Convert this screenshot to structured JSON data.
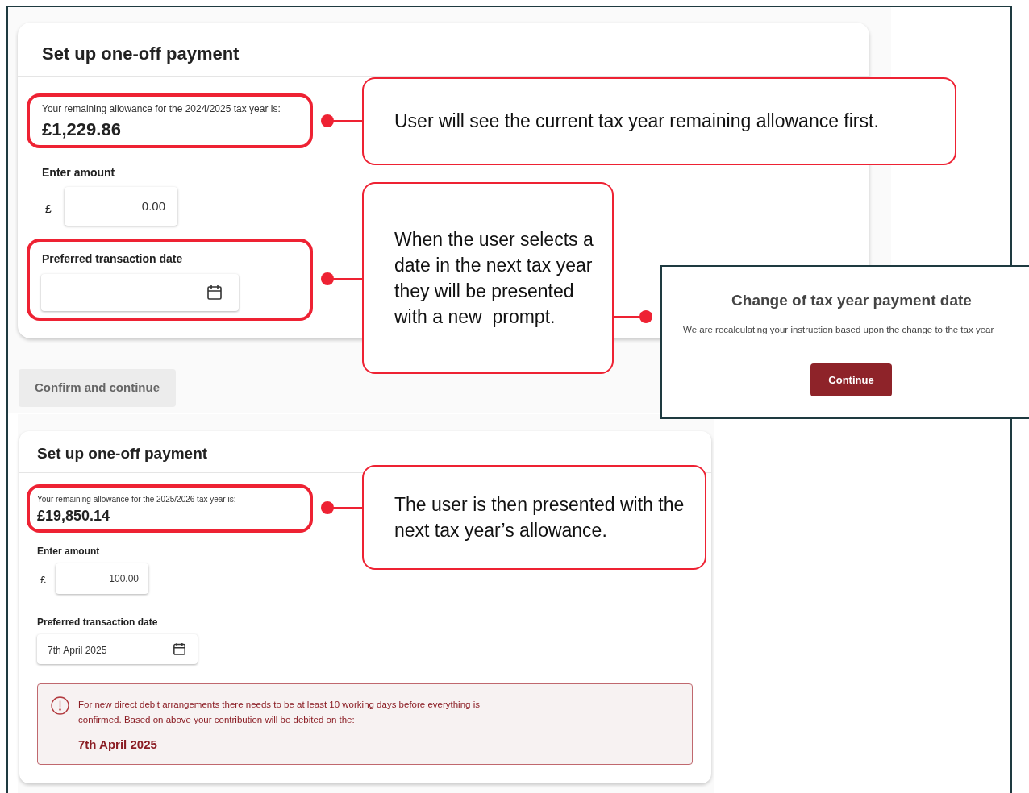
{
  "screen_before": {
    "title": "Set up one-off payment",
    "allowance_label": "Your remaining allowance for the 2024/2025 tax year is:",
    "allowance_amount": "£1,229.86",
    "amount_label": "Enter amount",
    "currency": "£",
    "amount_value": "0.00",
    "date_label": "Preferred transaction date",
    "confirm_button": {
      "label": "Confirm and continue",
      "disabled": true
    }
  },
  "modal": {
    "title": "Change of tax year payment date",
    "message": "We are recalculating your instruction based upon the change to the tax year",
    "button": "Continue"
  },
  "screen_after": {
    "title": "Set up one-off payment",
    "allowance_label": "Your remaining allowance for the 2025/2026 tax year is:",
    "allowance_amount": "£19,850.14",
    "amount_label": "Enter amount",
    "currency": "£",
    "amount_value": "100.00",
    "date_label": "Preferred transaction date",
    "date_value": "7th April 2025",
    "notice": {
      "text": "For new direct debit arrangements there needs to be at least 10 working days before everything is confirmed. Based on above your contribution will be debited on the:",
      "date": "7th April 2025"
    }
  },
  "callouts": [
    {
      "text": "User will see the current tax year remaining allowance first."
    },
    {
      "text": "When the user selects a date in the next tax year they will be presented with a new  prompt."
    },
    {
      "text": "The user is then presented with the next tax year’s allowance."
    }
  ]
}
